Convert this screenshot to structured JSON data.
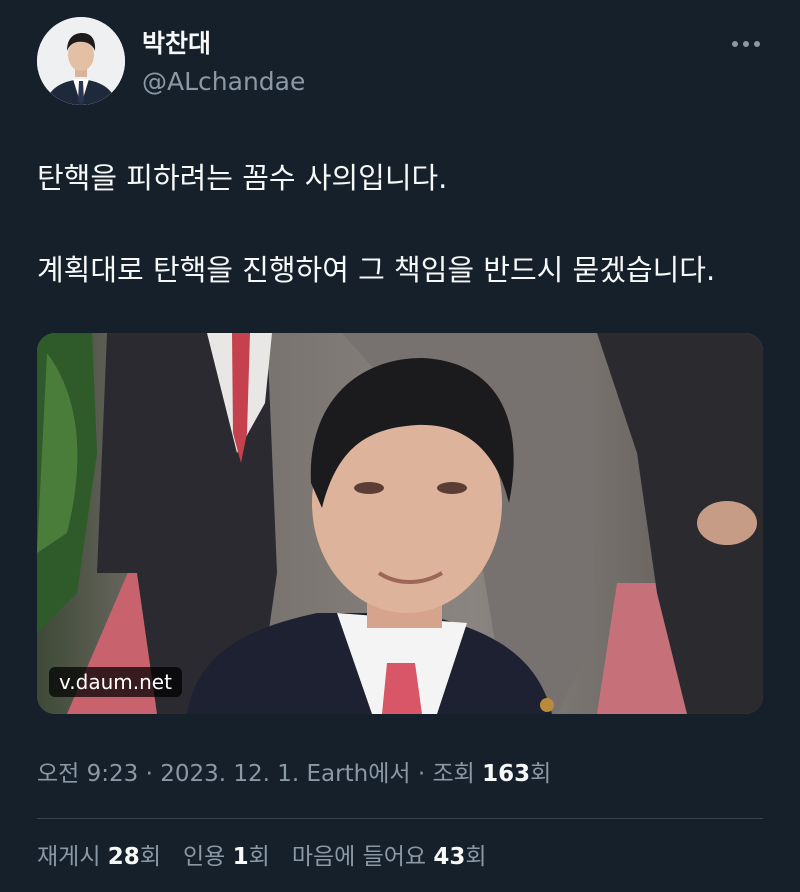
{
  "author": {
    "display_name": "박찬대",
    "handle": "@ALchandae",
    "avatar_icon": "person-avatar-icon"
  },
  "menu": {
    "more_icon": "more-horizontal-icon"
  },
  "tweet": {
    "line1": "탄핵을 피하려는 꼼수 사의입니다.",
    "line2": "계획대로 탄핵을 진행하여 그 책임을 반드시 묻겠습니다."
  },
  "media": {
    "link_domain": "v.daum.net"
  },
  "meta": {
    "time": "오전 9:23",
    "sep1": " · ",
    "date": "2023. 12. 1.",
    "source": " Earth에서",
    "sep2": " · ",
    "views_prefix": "조회 ",
    "views_count": "163",
    "views_suffix": "회"
  },
  "stats": {
    "retweets_label": "재게시 ",
    "retweets_count": "28",
    "retweets_suffix": "회",
    "quotes_label": "인용 ",
    "quotes_count": "1",
    "quotes_suffix": "회",
    "likes_label": "마음에 들어요 ",
    "likes_count": "43",
    "likes_suffix": "회"
  },
  "colors": {
    "background": "#15202b",
    "primary_text": "#f7f9f9",
    "secondary_text": "#8b98a5",
    "divider": "#38444d"
  }
}
